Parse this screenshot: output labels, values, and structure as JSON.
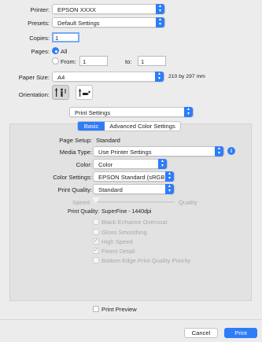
{
  "colors": {
    "accent": "#2f7df6",
    "window_bg": "#ececec",
    "panel_bg": "#e2e2e2"
  },
  "printer": {
    "label": "Printer:",
    "value": "EPSON XXXX"
  },
  "presets": {
    "label": "Presets:",
    "value": "Default Settings"
  },
  "copies": {
    "label": "Copies:",
    "value": "1"
  },
  "pages": {
    "label": "Pages:",
    "all_label": "All",
    "from_label": "From:",
    "from_value": "1",
    "to_label": "to:",
    "to_value": "1",
    "selected": "All"
  },
  "paper_size": {
    "label": "Paper Size:",
    "value": "A4",
    "dimensions": "210 by 297 mm"
  },
  "orientation": {
    "label": "Orientation:",
    "options": [
      "portrait-icon",
      "landscape-icon"
    ],
    "selected": "portrait"
  },
  "section_popup": {
    "value": "Print Settings"
  },
  "tabs": [
    {
      "label": "Basic",
      "selected": true
    },
    {
      "label": "Advanced Color Settings",
      "selected": false
    }
  ],
  "page_setup": {
    "label": "Page Setup:",
    "value": "Standard"
  },
  "media_type": {
    "label": "Media Type:",
    "value": "Use Printer Settings"
  },
  "color": {
    "label": "Color:",
    "value": "Color"
  },
  "color_settings": {
    "label": "Color Settings:",
    "value": "EPSON Standard (sRGB)"
  },
  "print_quality": {
    "label": "Print Quality:",
    "value": "Standard"
  },
  "slider": {
    "left_label": "Speed",
    "right_label": "Quality",
    "position": 0
  },
  "quality_readout": {
    "label": "Print Quality:",
    "value": "SuperFine - 1440dpi"
  },
  "options": [
    {
      "label": "Black Enhance Overcoat",
      "checked": false
    },
    {
      "label": "Gloss Smoothing",
      "checked": false
    },
    {
      "label": "High Speed",
      "checked": true
    },
    {
      "label": "Finest Detail",
      "checked": true
    },
    {
      "label": "Bottom Edge Print Quality Priority",
      "checked": false
    }
  ],
  "print_preview": {
    "label": "Print Preview",
    "checked": false
  },
  "footer": {
    "cancel": "Cancel",
    "print": "Print"
  }
}
